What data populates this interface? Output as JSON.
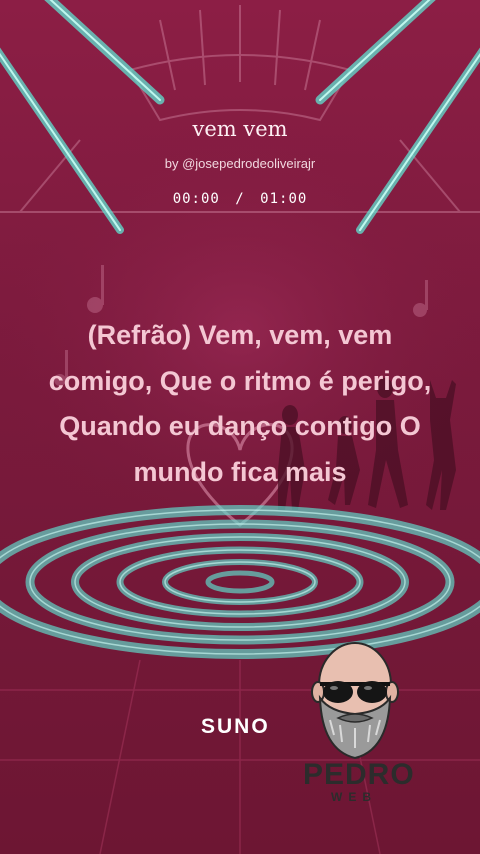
{
  "track": {
    "title": "vem vem",
    "byline": "by @josepedrodeoliveirajr",
    "current_time": "00:00",
    "separator": "/",
    "total_time": "01:00"
  },
  "lyrics": {
    "text": "(Refrão) Vem, vem, vem comigo, Que o ritmo é perigo, Quando eu danço contigo O mundo fica mais"
  },
  "branding": {
    "suno": "SUNO",
    "pedro": "PEDRO",
    "web": "WEB"
  },
  "colors": {
    "background": "#7a1838",
    "accent_teal": "#5fe3d2",
    "lyric_text": "#f4c7d3"
  }
}
